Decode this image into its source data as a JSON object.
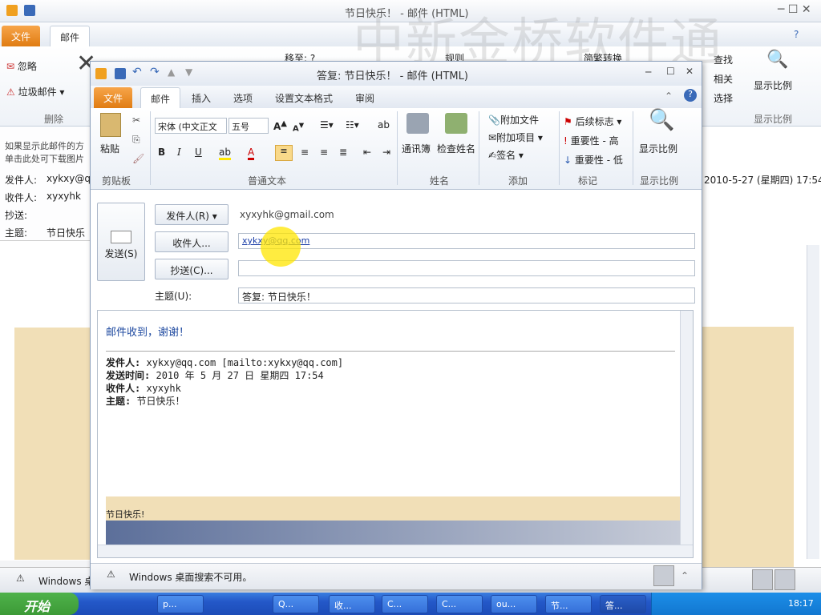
{
  "bg_window": {
    "title": "节日快乐！ - 邮件 (HTML)",
    "tabs": [
      "文件",
      "邮件"
    ],
    "ribbon_items": [
      "忽略",
      "垃圾邮件",
      "删除",
      "移至: ?",
      "规则",
      "简繁转换",
      "查找",
      "相关",
      "选择",
      "显示比例",
      "显示比例"
    ],
    "msg_info": [
      "如果显示此邮件的方",
      "单击此处可下载图片"
    ],
    "headers": [
      {
        "label": "发件人:",
        "value": "xykxy@q"
      },
      {
        "label": "收件人:",
        "value": "xyxyhk"
      },
      {
        "label": "抄送:",
        "value": ""
      },
      {
        "label": "主题:",
        "value": "节日快乐"
      }
    ],
    "sent_date": "2010-5-27 (星期四) 17:54",
    "status": "Windows 桌"
  },
  "watermark": "中新金桥软件通",
  "compose": {
    "title": "答复: 节日快乐！ - 邮件 (HTML)",
    "tabs": [
      "文件",
      "邮件",
      "插入",
      "选项",
      "设置文本格式",
      "审阅"
    ],
    "ribbon": {
      "paste": "粘贴",
      "clipboard": "剪贴板",
      "font_name": "宋体 (中文正文",
      "font_size": "五号",
      "basic_text": "普通文本",
      "address_book": "通讯簿",
      "check_names": "检查姓名",
      "names": "姓名",
      "attach_file": "附加文件",
      "attach_item": "附加项目",
      "signature": "签名",
      "include": "添加",
      "follow_up": "后续标志",
      "high_importance": "重要性 - 高",
      "low_importance": "重要性 - 低",
      "tags": "标记",
      "zoom": "显示比例",
      "zoom_group": "显示比例"
    },
    "send": "发送(S)",
    "from_btn": "发件人(R)",
    "from_value": "xyxyhk@gmail.com",
    "to_btn": "收件人...",
    "to_value": "xykxy@qq.com",
    "cc_btn": "抄送(C)...",
    "cc_value": "",
    "subject_label": "主题(U):",
    "subject_value": "答复: 节日快乐！",
    "body": {
      "reply_line": "邮件收到，谢谢！",
      "from_label": "发件人:",
      "from_value": "xykxy@qq.com [mailto:xykxy@qq.com]",
      "sent_label": "发送时间:",
      "sent_value": "2010 年 5 月 27 日 星期四 17:54",
      "to_label": "收件人:",
      "to_value": "xyxyhk",
      "subject_label": "主题:",
      "subject_value": "节日快乐！",
      "banner_text": "节日快乐!"
    },
    "status": "Windows 桌面搜索不可用。"
  },
  "taskbar": {
    "start": "开始",
    "items": [
      "p...",
      "Q...",
      "收...",
      "C...",
      "C...",
      "ou...",
      "节...",
      "答..."
    ],
    "clock": "18:17"
  },
  "colors": {
    "file_tab": "#e07c12",
    "taskbar": "#2458c8",
    "start": "#3c9a37",
    "highlight": "#ffe600"
  }
}
